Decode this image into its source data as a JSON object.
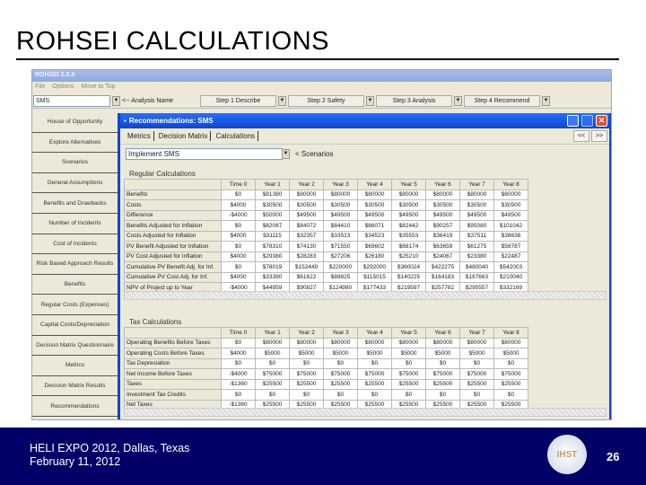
{
  "slide": {
    "title": "ROHSEI CALCULATIONS",
    "footer_line1": "HELI EXPO 2012, Dallas, Texas",
    "footer_line2": "February 11, 2012",
    "page_number": "26",
    "logo_text": "IHST"
  },
  "app": {
    "title": "ROHSEI 2.5.8",
    "menu": [
      "File",
      "Options",
      "Move to Top"
    ],
    "toolbar": {
      "analysis_value": "SMS",
      "analysis_label": "<-- Analysis Name",
      "steps": [
        "Step 1 Describe",
        "Step 2 Safety",
        "Step 3 Analysis",
        "Step 4 Recommend"
      ]
    },
    "sidebar": [
      "House of Opportunity",
      "Explore Alternatives",
      "Scenarios",
      "General Assumptions",
      "Benefits and Drawbacks",
      "Number of Incidents",
      "Cost of Incidents",
      "Risk Based Approach Results",
      "Benefits",
      "Regular Costs (Expenses)",
      "Capital Costs/Depreciation",
      "Decision Matrix Questionnaire",
      "Metrics",
      "Decision Matrix Results",
      "Recommendations"
    ]
  },
  "dialog": {
    "title": "Recommendations: SMS",
    "tabs": [
      "Metrics",
      "Decision Matrix",
      "Calculations"
    ],
    "prev": "<<",
    "next": ">>",
    "scenario_value": "Implement SMS",
    "scenario_label": "< Scenarios",
    "regular_title": "Regular Calculations",
    "tax_title": "Tax Calculations",
    "columns": [
      "Time 0",
      "Year 1",
      "Year 2",
      "Year 3",
      "Year 4",
      "Year 5",
      "Year 6",
      "Year 7",
      "Year 8"
    ],
    "regular_rows": [
      {
        "label": "Benefits",
        "values": [
          "$0",
          "$81380",
          "$80000",
          "$80000",
          "$80000",
          "$80000",
          "$80000",
          "$80000",
          "$80000"
        ]
      },
      {
        "label": "Costs",
        "values": [
          "$4000",
          "$30500",
          "$30500",
          "$30500",
          "$30500",
          "$30500",
          "$30500",
          "$30500",
          "$30500"
        ]
      },
      {
        "label": "Difference",
        "values": [
          "-$4000",
          "$50000",
          "$49500",
          "$49500",
          "$49500",
          "$49500",
          "$49500",
          "$49500",
          "$49500"
        ]
      },
      {
        "label": "Benefits Adjusted for Inflation",
        "values": [
          "$0",
          "$82087",
          "$84072",
          "$84410",
          "$86071",
          "$82442",
          "$90257",
          "$95080",
          "$101042"
        ]
      },
      {
        "label": "Costs Adjusted for Inflation",
        "values": [
          "$4000",
          "$31115",
          "$32357",
          "$33523",
          "$34523",
          "$35553",
          "$36419",
          "$37511",
          "$38636"
        ]
      },
      {
        "label": "PV Benefit Adjusted for Inflation",
        "values": [
          "$0",
          "$78310",
          "$74130",
          "$71550",
          "$69602",
          "$68174",
          "$63659",
          "$61275",
          "$58787"
        ]
      },
      {
        "label": "PV Cost Adjusted for Inflation",
        "values": [
          "$4000",
          "$29380",
          "$28283",
          "$27206",
          "$26180",
          "$25210",
          "$24067",
          "$23380",
          "$22487"
        ]
      },
      {
        "label": "Cumulative PV Benefit Adj. for Inf.",
        "values": [
          "$0",
          "$78019",
          "$152449",
          "$220000",
          "$292000",
          "$360024",
          "$422275",
          "$480040",
          "$542003"
        ]
      },
      {
        "label": "Cumulative PV Cost Adj. for Inf.",
        "values": [
          "$4000",
          "$33380",
          "$61622",
          "$88825",
          "$115015",
          "$140225",
          "$164183",
          "$187663",
          "$210040"
        ]
      },
      {
        "label": "NPV of Project up to Year",
        "values": [
          "-$4000",
          "$44959",
          "$90827",
          "$124980",
          "$177433",
          "$219597",
          "$257782",
          "$295557",
          "$332169"
        ]
      }
    ],
    "tax_rows": [
      {
        "label": "Operating Benefits Before Taxes",
        "values": [
          "$0",
          "$80000",
          "$80000",
          "$80000",
          "$80000",
          "$80000",
          "$80000",
          "$80000",
          "$80000"
        ]
      },
      {
        "label": "Operating Costs Before Taxes",
        "values": [
          "$4000",
          "$5000",
          "$5000",
          "$5000",
          "$5000",
          "$5000",
          "$5000",
          "$5000",
          "$5000"
        ]
      },
      {
        "label": "Tax Depreciation",
        "values": [
          "$0",
          "$0",
          "$0",
          "$0",
          "$0",
          "$0",
          "$0",
          "$0",
          "$0"
        ]
      },
      {
        "label": "Net Income Before Taxes",
        "values": [
          "-$4000",
          "$75000",
          "$75000",
          "$75000",
          "$75000",
          "$75000",
          "$75000",
          "$75000",
          "$75000"
        ]
      },
      {
        "label": "Taxes",
        "values": [
          "-$1360",
          "$25500",
          "$25500",
          "$25500",
          "$25500",
          "$25500",
          "$25500",
          "$25500",
          "$25500"
        ]
      },
      {
        "label": "Investment Tax Credits",
        "values": [
          "$0",
          "$0",
          "$0",
          "$0",
          "$0",
          "$0",
          "$0",
          "$0",
          "$0"
        ]
      },
      {
        "label": "Net Taxes",
        "values": [
          "-$1360",
          "$25500",
          "$25500",
          "$25500",
          "$25500",
          "$25500",
          "$25500",
          "$25500",
          "$25500"
        ]
      }
    ]
  }
}
